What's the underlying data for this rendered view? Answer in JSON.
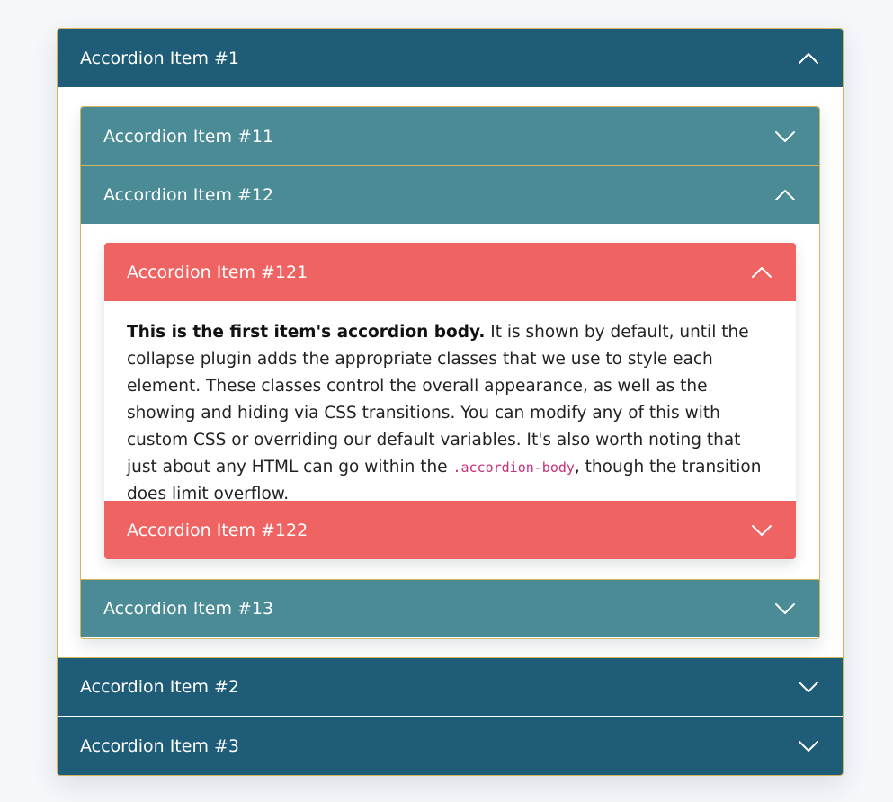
{
  "accordion": {
    "items": [
      {
        "label": "Accordion Item #1",
        "expanded": true,
        "children": [
          {
            "label": "Accordion Item #11",
            "expanded": false
          },
          {
            "label": "Accordion Item #12",
            "expanded": true,
            "children": [
              {
                "label": "Accordion Item #121",
                "expanded": true,
                "body": {
                  "strong": "This is the first item's accordion body.",
                  "text_1": " It is shown by default, until the collapse plugin adds the appropriate classes that we use to style each element. These classes control the overall appearance, as well as the showing and hiding via CSS transitions. You can modify any of this with custom CSS or overriding our default variables. It's also worth noting that just about any HTML can go within the ",
                  "code": ".accordion-body",
                  "text_2": ", though the transition does limit overflow."
                }
              },
              {
                "label": "Accordion Item #122",
                "expanded": false
              }
            ]
          },
          {
            "label": "Accordion Item #13",
            "expanded": false
          }
        ]
      },
      {
        "label": "Accordion Item #2",
        "expanded": false
      },
      {
        "label": "Accordion Item #3",
        "expanded": false
      }
    ]
  },
  "icons": {
    "expanded": "chevron-up-icon",
    "collapsed": "chevron-down-icon"
  },
  "colors": {
    "page_background": "#f6f7fb",
    "level1_header": "#1f5c78",
    "level2_header": "#4a8b95",
    "level3_header": "#ef6463",
    "border": "#d3b35c",
    "code_text": "#c7307a"
  }
}
